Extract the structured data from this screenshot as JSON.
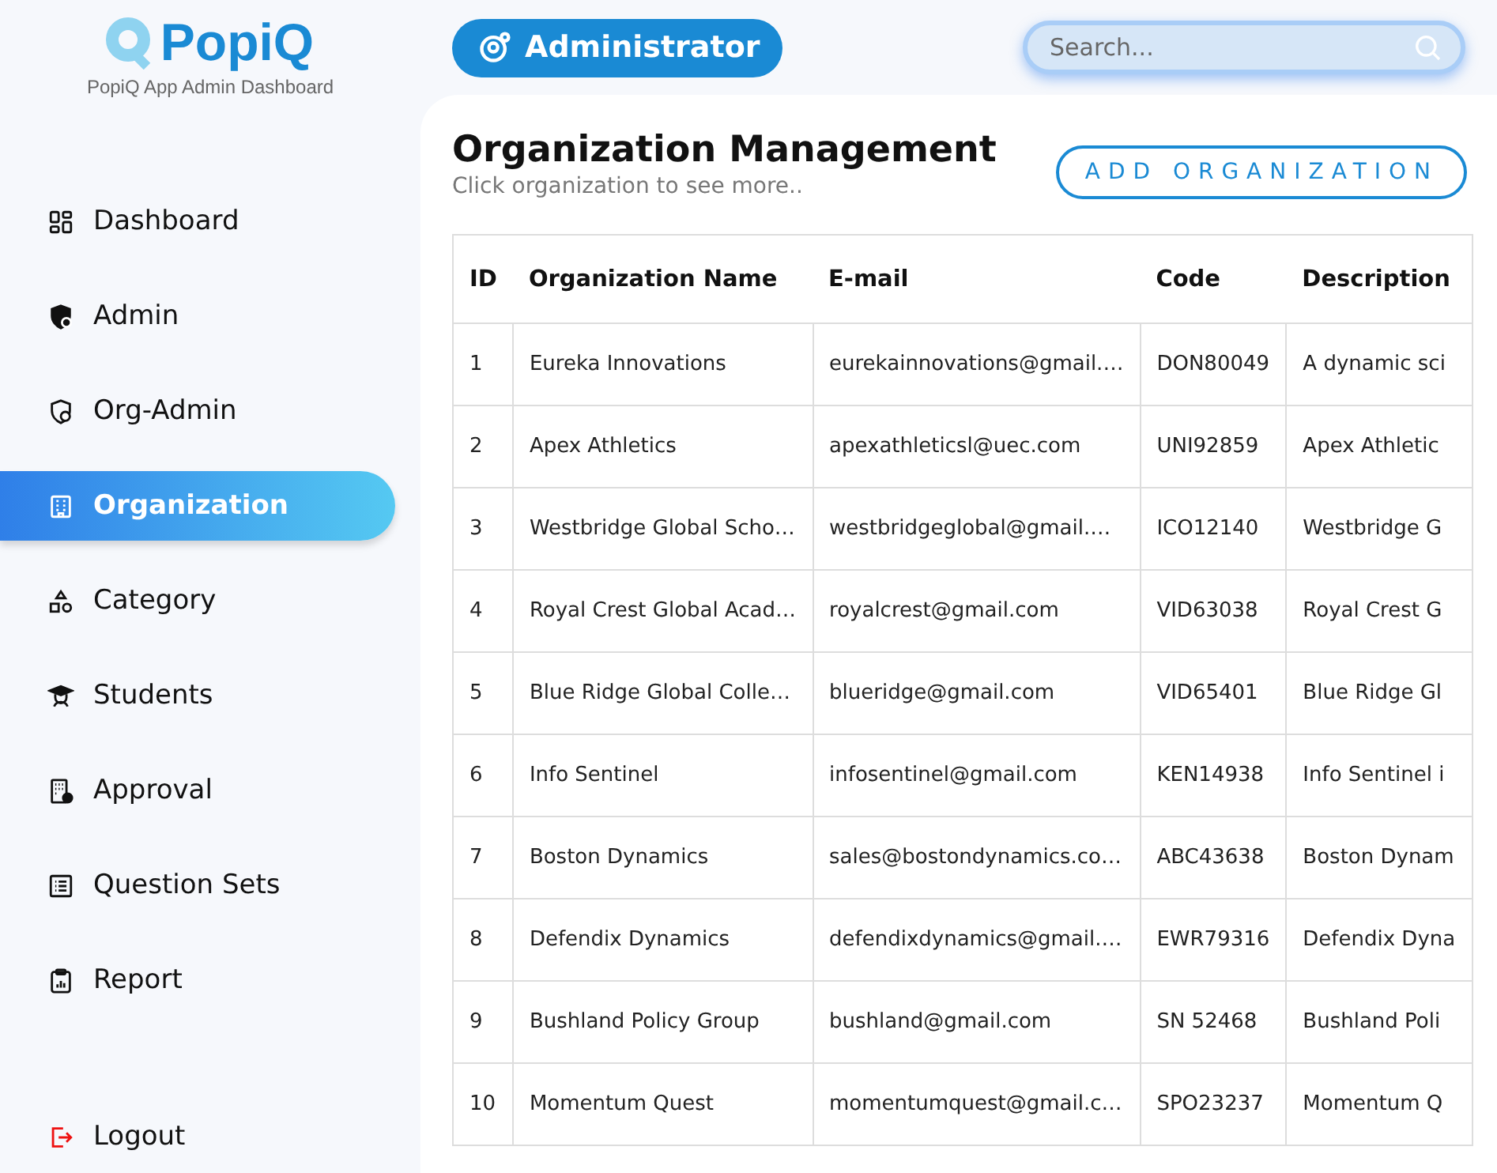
{
  "brand": {
    "name": "PopiQ",
    "subtitle": "PopiQ App Admin Dashboard"
  },
  "nav": [
    {
      "label": "Dashboard",
      "selected": false
    },
    {
      "label": "Admin",
      "selected": false
    },
    {
      "label": "Org-Admin",
      "selected": false
    },
    {
      "label": "Organization",
      "selected": true
    },
    {
      "label": "Category",
      "selected": false
    },
    {
      "label": "Students",
      "selected": false
    },
    {
      "label": "Approval",
      "selected": false
    },
    {
      "label": "Question Sets",
      "selected": false
    },
    {
      "label": "Report",
      "selected": false
    }
  ],
  "logout": {
    "label": "Logout"
  },
  "role_button": {
    "label": "Administrator"
  },
  "search": {
    "placeholder": "Search..."
  },
  "page": {
    "title": "Organization Management",
    "subtitle": "Click organization to see more..",
    "add_button": "ADD ORGANIZATION"
  },
  "table": {
    "columns": [
      "ID",
      "Organization Name",
      "E-mail",
      "Code",
      "Description"
    ],
    "rows": [
      [
        "1",
        "Eureka Innovations",
        "eurekainnovations@gmail.…",
        "DON80049",
        "A dynamic sci"
      ],
      [
        "2",
        "Apex Athletics",
        "apexathleticsl@uec.com",
        "UNI92859",
        "Apex Athletic"
      ],
      [
        "3",
        "Westbridge Global Scho…",
        "westbridgeglobal@gmail.…",
        "ICO12140",
        "Westbridge G"
      ],
      [
        "4",
        "Royal Crest Global Acad…",
        "royalcrest@gmail.com",
        "VID63038",
        "Royal Crest G"
      ],
      [
        "5",
        "Blue Ridge Global Colle…",
        "blueridge@gmail.com",
        "VID65401",
        "Blue Ridge Gl"
      ],
      [
        "6",
        "Info Sentinel",
        "infosentinel@gmail.com",
        "KEN14938",
        "Info Sentinel i"
      ],
      [
        "7",
        "Boston Dynamics",
        "sales@bostondynamics.co…",
        "ABC43638",
        "Boston Dynam"
      ],
      [
        "8",
        "Defendix Dynamics",
        "defendixdynamics@gmail.…",
        "EWR79316",
        "Defendix Dyna"
      ],
      [
        "9",
        "Bushland Policy Group",
        "bushland@gmail.com",
        "SN 52468",
        "Bushland Poli"
      ],
      [
        "10",
        "Momentum Quest",
        "momentumquest@gmail.c…",
        "SPO23237",
        "Momentum Q"
      ]
    ]
  }
}
